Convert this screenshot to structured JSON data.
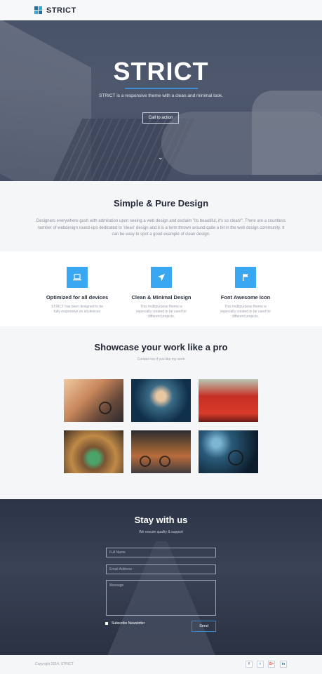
{
  "header": {
    "brand": "STRICT"
  },
  "hero": {
    "title": "STRICT",
    "subtitle": "STRICT is a responsive theme with a clean and minimal look.",
    "cta": "Call to action",
    "scroll_icon": "chevron-down-icon"
  },
  "intro": {
    "heading": "Simple & Pure Design",
    "text": "Designers everywhere gush with admiration upon seeing a web design and exclaim \"its beautiful, it's so clean!\". There are a countless number of webdesign round-ups dedicated to 'clean' design and it is a term thrown around quite a bit in the web design community. It can be easy to spot a good example of clean design."
  },
  "features": [
    {
      "icon": "laptop-icon",
      "title": "Optimized for all devices",
      "text": "STRICT has been designed to be fully responsive on all devices"
    },
    {
      "icon": "paper-plane-icon",
      "title": "Clean & Minimal Design",
      "text": "This multipurpose theme is especially created to be used for different projects."
    },
    {
      "icon": "flag-icon",
      "title": "Font Awesome Icon",
      "text": "This multipurpose theme is especially created to be used for different projects."
    }
  ],
  "portfolio": {
    "heading": "Showcase your work like a pro",
    "subtitle": "Contact me if you like my work"
  },
  "contact": {
    "heading": "Stay with us",
    "subtitle": "We ensure quality & support",
    "name_placeholder": "Full Name",
    "email_placeholder": "Email Address",
    "message_placeholder": "Message",
    "subscribe_label": "Subscribe Newsletter",
    "send_label": "Send"
  },
  "footer": {
    "copyright": "Copyright 2014, STRICT",
    "social": {
      "facebook": "f",
      "twitter": "t",
      "google": "G+",
      "linkedin": "in"
    }
  },
  "colors": {
    "accent": "#3aa7f2",
    "dark": "#2c3447"
  }
}
